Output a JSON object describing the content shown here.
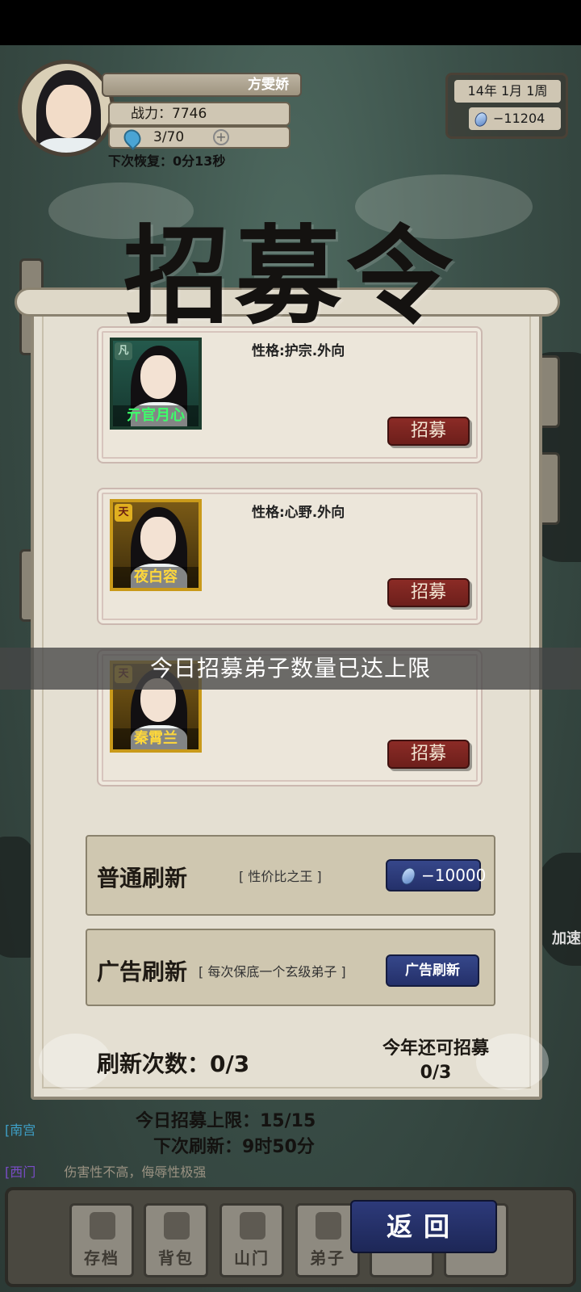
{
  "player": {
    "name": "方雯娇",
    "power": "战力：7746",
    "stamina": "3/70",
    "recover": "下次恢复：0分13秒"
  },
  "calendar": {
    "date": "14年 1月 1周",
    "gems": "−11204"
  },
  "dialog": {
    "title": "招募令",
    "recruit_label": "招募",
    "candidates": [
      {
        "name": "亓官月心",
        "rank": "凡",
        "personality": "性格:护宗.外向"
      },
      {
        "name": "夜白容",
        "rank": "天",
        "personality": "性格:心野.外向"
      },
      {
        "name": "秦霄兰",
        "rank": "天",
        "personality": ""
      }
    ],
    "toast": "今日招募弟子数量已达上限",
    "normal_refresh": {
      "title": "普通刷新",
      "desc": "[ 性价比之王 ]",
      "cost": "−10000"
    },
    "ad_refresh": {
      "title": "广告刷新",
      "desc": "[ 每次保底一个玄级弟子 ]",
      "button": "广告刷新"
    },
    "refresh_count": "刷新次数：0/3",
    "year_limit": "今年还可招募0/3"
  },
  "limits": {
    "daily": "今日招募上限：15/15",
    "next": "下次刷新：9时50分"
  },
  "chat": {
    "line1_name": "[南宫",
    "line2_name": "[西门",
    "line2_text": "伤害性不高，侮辱性极强"
  },
  "nav": {
    "items": [
      "存档",
      "背包",
      "山门",
      "弟子"
    ],
    "back": "返回"
  },
  "speed_label": "加速"
}
